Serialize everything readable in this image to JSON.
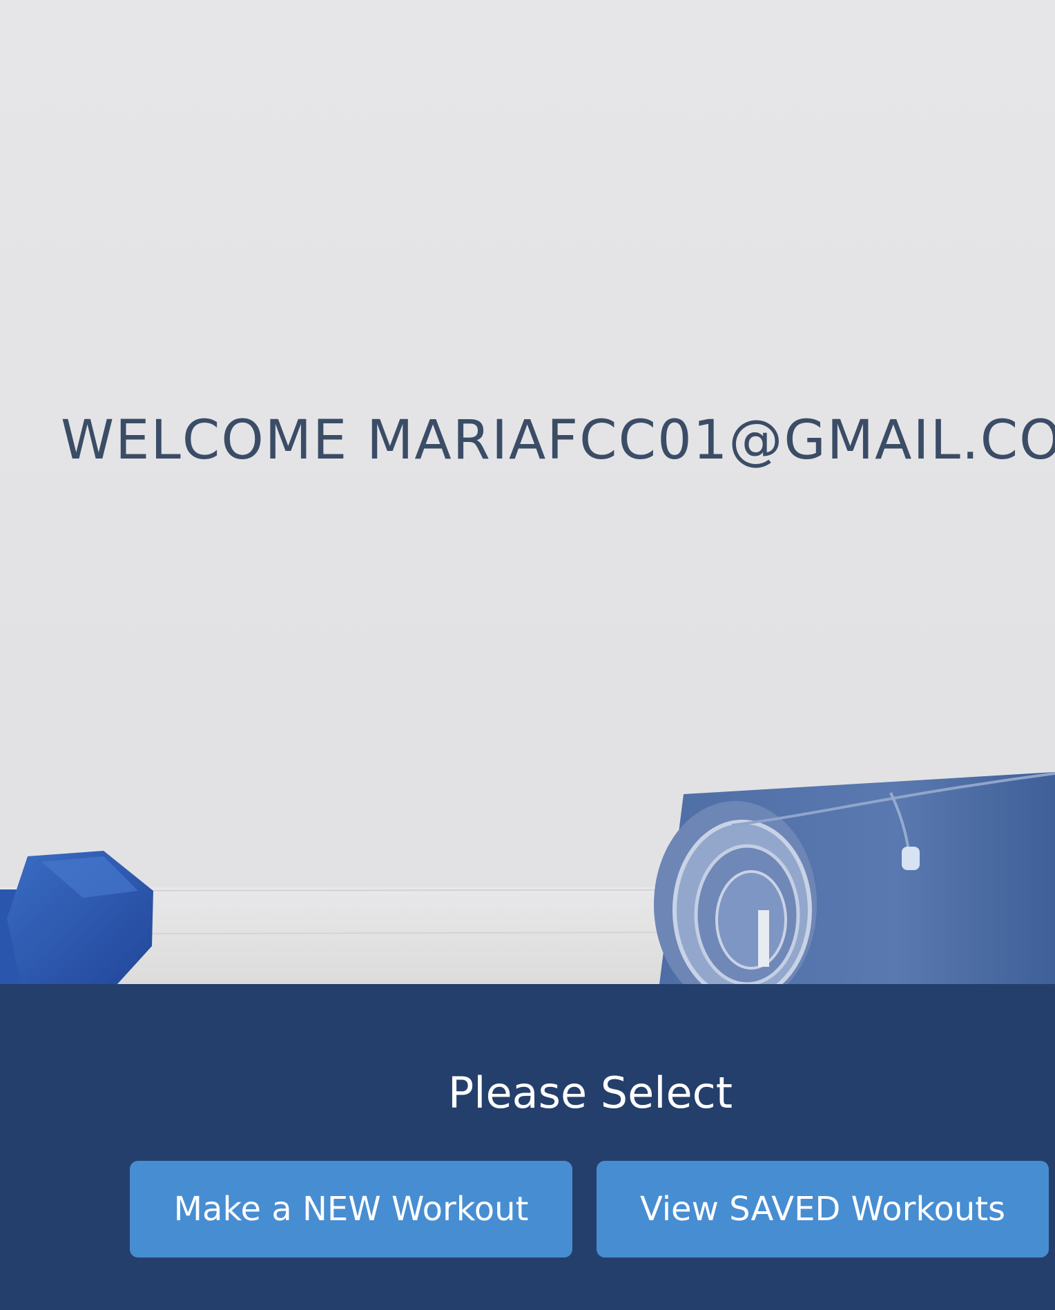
{
  "hero": {
    "welcome_text": "WELCOME MARIAFCC01@GMAIL.CO"
  },
  "selection_panel": {
    "title": "Please Select",
    "buttons": {
      "new_workout_label": "Make a NEW Workout",
      "saved_workouts_label": "View SAVED Workouts"
    }
  },
  "colors": {
    "wall_background": "#e4e4e6",
    "welcome_text": "#3b4c66",
    "panel_background": "#243f6c",
    "button_background": "#478dd2",
    "button_text": "#ffffff",
    "dumbbell": "#2f5fb8",
    "yoga_mat": "#5877ad"
  },
  "icons": {
    "hero_image": "dumbbell-and-yoga-mat-photo"
  }
}
